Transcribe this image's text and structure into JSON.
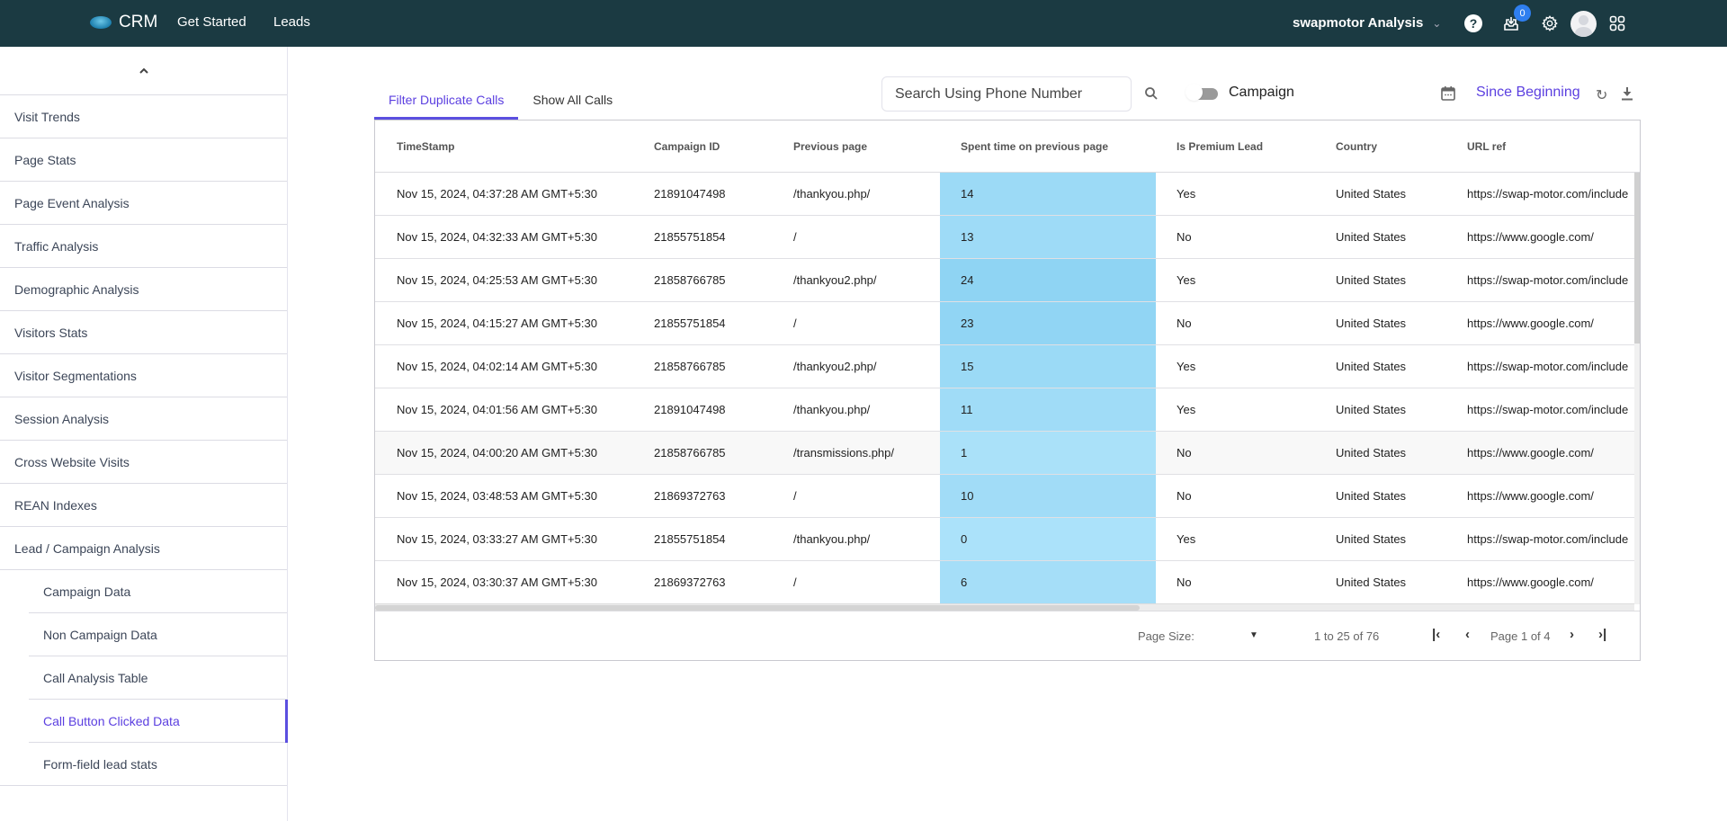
{
  "topbar": {
    "brand": "CRM",
    "nav": [
      "Get Started",
      "Leads"
    ],
    "account": "swapmotor Analysis",
    "notification_count": "0",
    "icons": [
      "help-icon",
      "inbox-download-icon",
      "gear-icon",
      "avatar",
      "apps-grid-icon"
    ]
  },
  "sidebar": {
    "collapse_icon": "chevron-up-icon",
    "items": [
      {
        "label": "Visit Trends"
      },
      {
        "label": "Page Stats"
      },
      {
        "label": "Page Event Analysis"
      },
      {
        "label": "Traffic Analysis"
      },
      {
        "label": "Demographic Analysis"
      },
      {
        "label": "Visitors Stats"
      },
      {
        "label": "Visitor Segmentations"
      },
      {
        "label": "Session Analysis"
      },
      {
        "label": "Cross Website Visits"
      },
      {
        "label": "REAN Indexes"
      },
      {
        "label": "Lead / Campaign Analysis"
      }
    ],
    "subitems": [
      {
        "label": "Campaign Data"
      },
      {
        "label": "Non Campaign Data"
      },
      {
        "label": "Call Analysis Table"
      },
      {
        "label": "Call Button Clicked Data",
        "active": true
      },
      {
        "label": "Form-field lead stats"
      }
    ]
  },
  "toolbar": {
    "tabs": [
      {
        "label": "Filter Duplicate Calls",
        "active": true
      },
      {
        "label": "Show All Calls",
        "active": false
      }
    ],
    "search_placeholder": "Search Using Phone Number",
    "search_value": "",
    "toggle_label": "Campaign",
    "toggle_on": false,
    "date_range": "Since Beginning"
  },
  "table": {
    "columns": [
      "TimeStamp",
      "Campaign ID",
      "Previous page",
      "Spent time on previous page",
      "Is Premium Lead",
      "Country",
      "URL ref"
    ],
    "rows": [
      {
        "timestamp": "Nov 15, 2024, 04:37:28 AM GMT+5:30",
        "campaign_id": "21891047498",
        "previous_page": "/thankyou.php/",
        "spent_time": "14",
        "premium": "Yes",
        "country": "United States",
        "url_ref": "https://swap-motor.com/include",
        "heat": "#9cdaf6"
      },
      {
        "timestamp": "Nov 15, 2024, 04:32:33 AM GMT+5:30",
        "campaign_id": "21855751854",
        "previous_page": "/",
        "spent_time": "13",
        "premium": "No",
        "country": "United States",
        "url_ref": "https://www.google.com/",
        "heat": "#9edbf7"
      },
      {
        "timestamp": "Nov 15, 2024, 04:25:53 AM GMT+5:30",
        "campaign_id": "21858766785",
        "previous_page": "/thankyou2.php/",
        "spent_time": "24",
        "premium": "Yes",
        "country": "United States",
        "url_ref": "https://swap-motor.com/include",
        "heat": "#8fd4f3"
      },
      {
        "timestamp": "Nov 15, 2024, 04:15:27 AM GMT+5:30",
        "campaign_id": "21855751854",
        "previous_page": "/",
        "spent_time": "23",
        "premium": "No",
        "country": "United States",
        "url_ref": "https://www.google.com/",
        "heat": "#91d5f4"
      },
      {
        "timestamp": "Nov 15, 2024, 04:02:14 AM GMT+5:30",
        "campaign_id": "21858766785",
        "previous_page": "/thankyou2.php/",
        "spent_time": "15",
        "premium": "Yes",
        "country": "United States",
        "url_ref": "https://swap-motor.com/include",
        "heat": "#9bdaf6"
      },
      {
        "timestamp": "Nov 15, 2024, 04:01:56 AM GMT+5:30",
        "campaign_id": "21891047498",
        "previous_page": "/thankyou.php/",
        "spent_time": "11",
        "premium": "Yes",
        "country": "United States",
        "url_ref": "https://swap-motor.com/include",
        "heat": "#a0dcf7"
      },
      {
        "timestamp": "Nov 15, 2024, 04:00:20 AM GMT+5:30",
        "campaign_id": "21858766785",
        "previous_page": "/transmissions.php/",
        "spent_time": "1",
        "premium": "No",
        "country": "United States",
        "url_ref": "https://www.google.com/",
        "heat": "#aae1f9"
      },
      {
        "timestamp": "Nov 15, 2024, 03:48:53 AM GMT+5:30",
        "campaign_id": "21869372763",
        "previous_page": "/",
        "spent_time": "10",
        "premium": "No",
        "country": "United States",
        "url_ref": "https://www.google.com/",
        "heat": "#a1dcf7"
      },
      {
        "timestamp": "Nov 15, 2024, 03:33:27 AM GMT+5:30",
        "campaign_id": "21855751854",
        "previous_page": "/thankyou.php/",
        "spent_time": "0",
        "premium": "Yes",
        "country": "United States",
        "url_ref": "https://swap-motor.com/include",
        "heat": "#abe2fa"
      },
      {
        "timestamp": "Nov 15, 2024, 03:30:37 AM GMT+5:30",
        "campaign_id": "21869372763",
        "previous_page": "/",
        "spent_time": "6",
        "premium": "No",
        "country": "United States",
        "url_ref": "https://www.google.com/",
        "heat": "#a5def8"
      }
    ],
    "hover_row": 6
  },
  "pager": {
    "page_size_label": "Page Size:",
    "page_size_value": "",
    "range": "1 to 25 of 76",
    "page_label": "Page 1 of 4"
  },
  "colors": {
    "topbar": "#1b3a42",
    "accent": "#5b3fe0",
    "badge": "#2f7ff0"
  }
}
